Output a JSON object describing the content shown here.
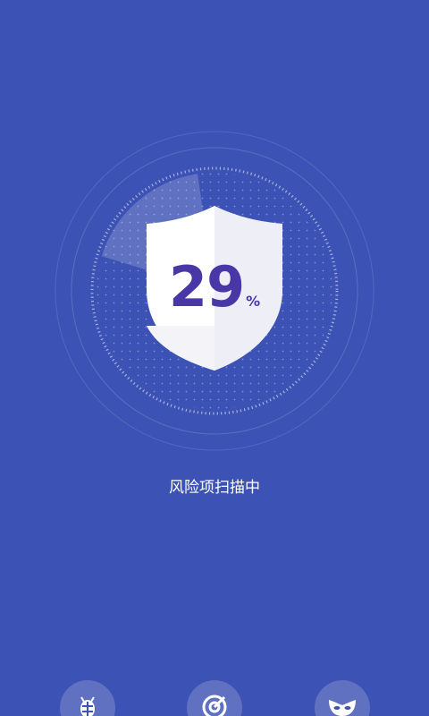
{
  "scan": {
    "progress_value": "29",
    "progress_unit": "%",
    "status_text": "风险项扫描中"
  },
  "bottom_tools": [
    {
      "icon": "bug-icon"
    },
    {
      "icon": "target-icon"
    },
    {
      "icon": "mask-icon"
    }
  ],
  "colors": {
    "background": "#3d52b5",
    "accent": "#4937a8",
    "text": "#ffffff"
  }
}
